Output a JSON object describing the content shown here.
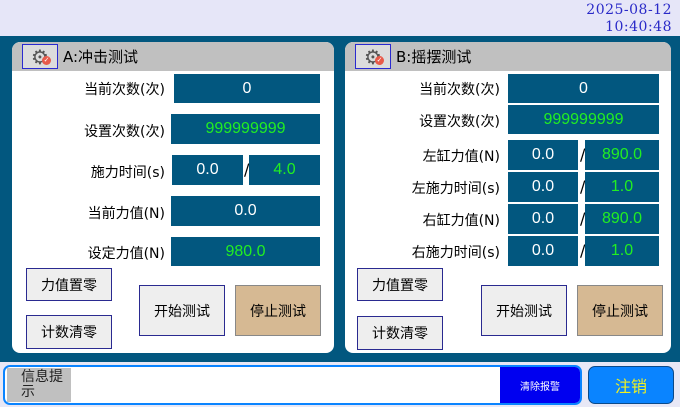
{
  "clock": {
    "date": "2025-08-12",
    "time": "10:40:48"
  },
  "panelA": {
    "title": "A:冲击测试",
    "rows": [
      {
        "label": "当前次数(次)",
        "value": "0"
      },
      {
        "label": "设置次数(次)",
        "value": "999999999"
      },
      {
        "label": "施力时间(s)",
        "current": "0.0",
        "set": "4.0"
      },
      {
        "label": "当前力值(N)",
        "value": "0.0"
      },
      {
        "label": "设定力值(N)",
        "value": "980.0"
      }
    ],
    "buttons": {
      "zero_force": "力值置零",
      "clear_count": "计数清零",
      "start": "开始测试",
      "stop": "停止测试"
    }
  },
  "panelB": {
    "title": "B:摇摆测试",
    "rows": [
      {
        "label": "当前次数(次)",
        "value": "0"
      },
      {
        "label": "设置次数(次)",
        "value": "999999999"
      },
      {
        "label": "左缸力值(N)",
        "current": "0.0",
        "set": "890.0"
      },
      {
        "label": "左施力时间(s)",
        "current": "0.0",
        "set": "1.0"
      },
      {
        "label": "右缸力值(N)",
        "current": "0.0",
        "set": "890.0"
      },
      {
        "label": "右施力时间(s)",
        "current": "0.0",
        "set": "1.0"
      }
    ],
    "buttons": {
      "zero_force": "力值置零",
      "clear_count": "计数清零",
      "start": "开始测试",
      "stop": "停止测试"
    }
  },
  "slash": "/",
  "footer": {
    "info_label": "信息提示",
    "info_text": "",
    "clear_alarm": "清除报警",
    "logout": "注销"
  },
  "colors": {
    "panel_bg": "#02577f",
    "set_value": "#22ee22",
    "stop_button": "#d6b993",
    "logout": "#0a84ff",
    "logout_text": "#f0f020"
  }
}
